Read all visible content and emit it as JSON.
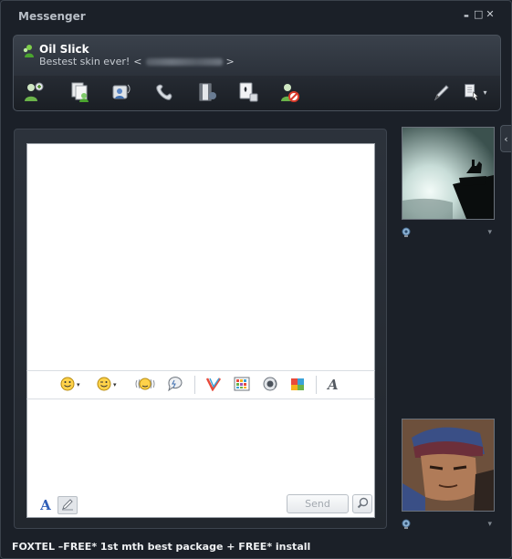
{
  "window": {
    "title": "Messenger"
  },
  "window_controls": {
    "minimize": "▬",
    "maximize": "□",
    "close": "✕"
  },
  "contact": {
    "name": "Oil Slick",
    "personal_message": "Bestest skin ever!",
    "email_open": "<",
    "email_close": ">"
  },
  "toolbar": {
    "icons": [
      "invite-contact-icon",
      "share-files-icon",
      "video-call-icon",
      "voice-call-icon",
      "share-video-icon",
      "games-icon",
      "block-contact-icon"
    ],
    "right_icons": [
      "pen-icon",
      "menu-icon"
    ],
    "menu_caret": "▾"
  },
  "side_tab": {
    "glyph": "‹"
  },
  "emote_bar": {
    "caret": "▾",
    "font_glyph": "A"
  },
  "compose": {
    "font_label": "A",
    "send_label": "Send"
  },
  "display_pictures": {
    "dropdown_glyph": "▾"
  },
  "ad": {
    "text": "FOXTEL –FREE* 1st mth best package + FREE* install"
  },
  "colors": {
    "background": "#1b2028",
    "panel": "#2b313a",
    "accent": "#2f5fb8",
    "send_disabled_text": "#a2a8af"
  }
}
